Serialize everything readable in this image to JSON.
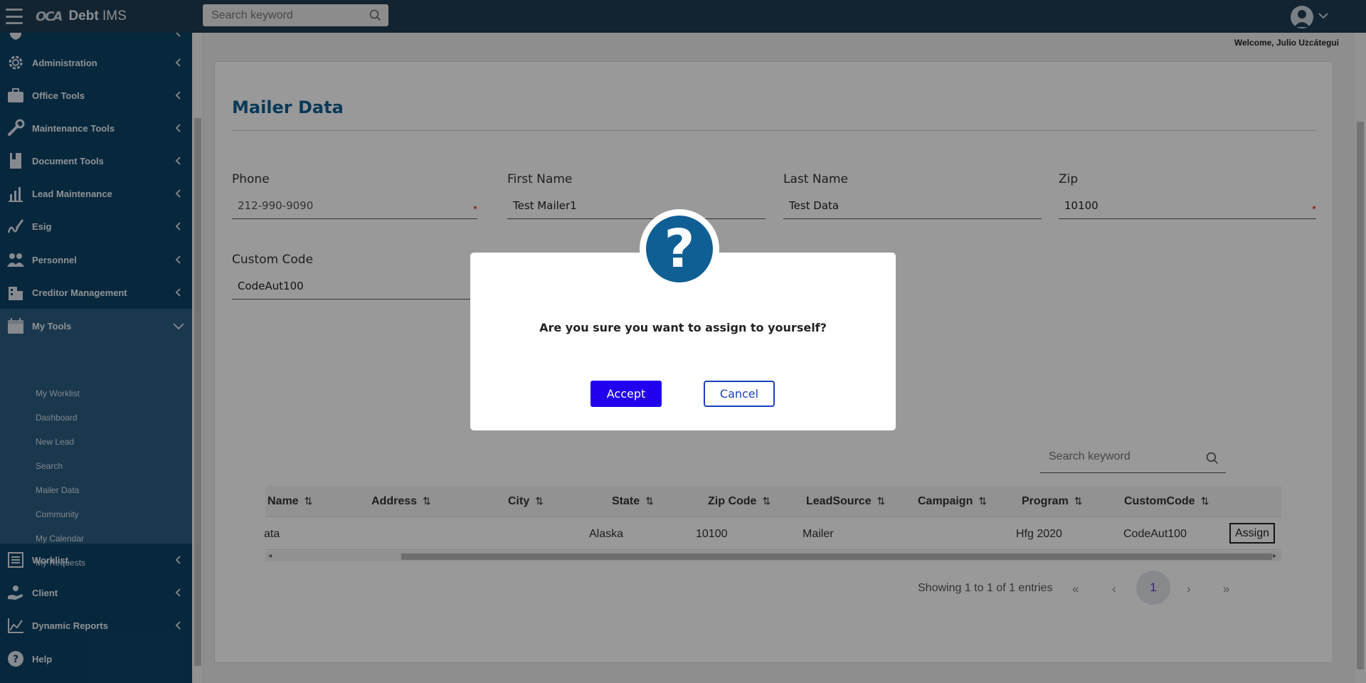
{
  "app": {
    "title_prefix": "Debt",
    "title_suffix": " IMS",
    "logo_mark": "OCA",
    "search_placeholder": "Search keyword",
    "welcome": "Welcome, Julio Uzcátegui"
  },
  "sidebar": {
    "items": [
      {
        "label": "Administration",
        "icon": "gear-icon"
      },
      {
        "label": "Office Tools",
        "icon": "briefcase-icon"
      },
      {
        "label": "Maintenance Tools",
        "icon": "wrench-icon"
      },
      {
        "label": "Document Tools",
        "icon": "document-icon"
      },
      {
        "label": "Lead Maintenance",
        "icon": "chart-icon"
      },
      {
        "label": "Esig",
        "icon": "signature-icon"
      },
      {
        "label": "Personnel",
        "icon": "people-icon"
      },
      {
        "label": "Creditor Management",
        "icon": "building-icon"
      },
      {
        "label": "My Tools",
        "icon": "calendar-icon"
      },
      {
        "label": "Worklist",
        "icon": "list-icon"
      },
      {
        "label": "Client",
        "icon": "hand-icon"
      },
      {
        "label": "Dynamic Reports",
        "icon": "report-icon"
      },
      {
        "label": "Help",
        "icon": "help-icon"
      }
    ],
    "submenu": [
      "My Worklist",
      "Dashboard",
      "New Lead",
      "Search",
      "Mailer Data",
      "Community",
      "My Calendar",
      "My Requests"
    ]
  },
  "form": {
    "title": "Mailer Data",
    "phone": {
      "label": "Phone",
      "value": "212-990-9090"
    },
    "first_name": {
      "label": "First Name",
      "value": "Test Mailer1"
    },
    "last_name": {
      "label": "Last Name",
      "value": "Test Data"
    },
    "zip": {
      "label": "Zip",
      "value": "10100"
    },
    "custom_code": {
      "label": "Custom Code",
      "value": "CodeAut100"
    },
    "required_mark": "*"
  },
  "table": {
    "search_placeholder": "Search keyword",
    "headers": [
      "Name",
      "Address",
      "City",
      "State",
      "Zip Code",
      "LeadSource",
      "Campaign",
      "Program",
      "CustomCode"
    ],
    "sort_glyph": "⇅",
    "row": {
      "name": "ata",
      "address": "",
      "city": "",
      "state": "Alaska",
      "zip": "10100",
      "lead_source": "Mailer",
      "campaign": "",
      "program": "Hfg 2020",
      "custom_code": "CodeAut100",
      "action": "Assign"
    },
    "showing": "Showing 1 to 1 of 1 entries",
    "pager": {
      "first": "«",
      "prev": "‹",
      "current": "1",
      "next": "›",
      "last": "»"
    }
  },
  "modal": {
    "icon": "question-icon",
    "glyph": "?",
    "message": "Are you sure you want to assign to yourself?",
    "accept": "Accept",
    "cancel": "Cancel"
  },
  "colors": {
    "topbar": "#1f3b53",
    "sidebar": "#0c4266",
    "accent": "#0f5f95",
    "accept": "#2100ee"
  }
}
